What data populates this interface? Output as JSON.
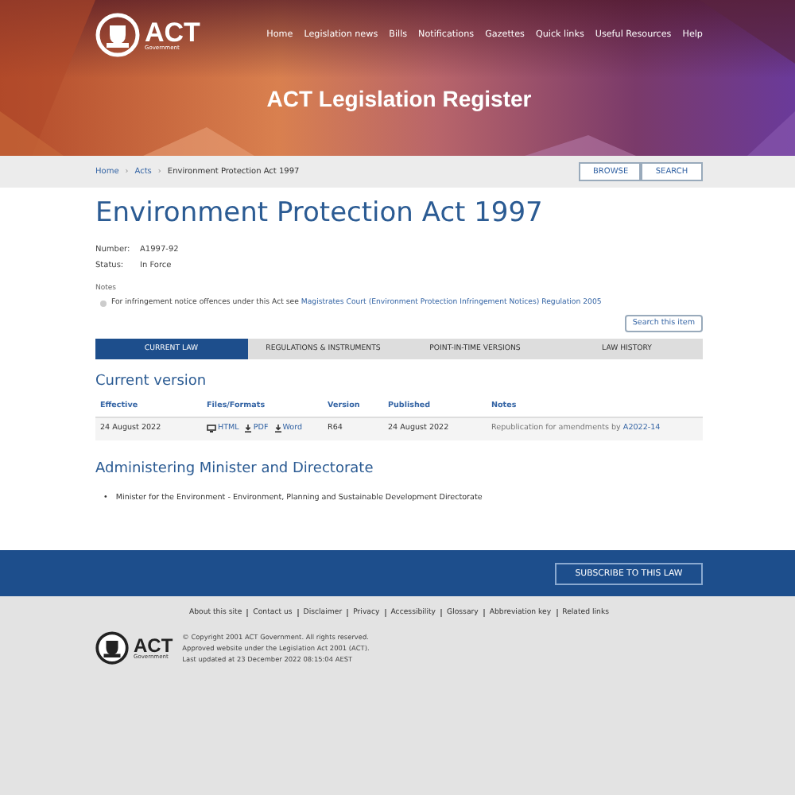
{
  "header": {
    "logo_text": "ACT",
    "logo_subtext": "Government",
    "nav": [
      "Home",
      "Legislation news",
      "Bills",
      "Notifications",
      "Gazettes",
      "Quick links",
      "Useful Resources",
      "Help"
    ],
    "site_title": "ACT Legislation Register"
  },
  "breadcrumb": {
    "separator": "›",
    "items": [
      "Home",
      "Acts",
      "Environment Protection Act 1997"
    ],
    "buttons": [
      "BROWSE",
      "SEARCH"
    ]
  },
  "title": "Environment Protection Act 1997",
  "details": [
    {
      "label": "Number:",
      "value": "A1997-92"
    },
    {
      "label": "Status:",
      "value": "In Force"
    }
  ],
  "notes_label": "Notes",
  "notes": [
    {
      "text": "For infringement notice offences under this Act see ",
      "link": "Magistrates Court (Environment Protection Infringement Notices) Regulation 2005"
    }
  ],
  "search_item_button": "Search this item",
  "tabs": [
    {
      "label": "CURRENT LAW",
      "selected": true
    },
    {
      "label": "REGULATIONS & INSTRUMENTS",
      "selected": false
    },
    {
      "label": "POINT-IN-TIME VERSIONS",
      "selected": false
    },
    {
      "label": "LAW HISTORY",
      "selected": false
    }
  ],
  "current_version": {
    "heading": "Current version",
    "columns": [
      "Effective",
      "Files/Formats",
      "Version",
      "Published",
      "Notes"
    ],
    "rows": [
      {
        "effective": "24 August 2022",
        "formats": [
          {
            "kind": "html",
            "label": "HTML"
          },
          {
            "kind": "download",
            "label": "PDF"
          },
          {
            "kind": "download",
            "label": "Word"
          }
        ],
        "version": "R64",
        "published": "24 August 2022",
        "note_text": "Republication for amendments by ",
        "note_link": "A2022-14"
      }
    ]
  },
  "administering": {
    "heading": "Administering Minister and Directorate",
    "items": [
      {
        "marker": "•",
        "text": "Minister for the Environment - Environment, Planning and Sustainable Development Directorate"
      }
    ]
  },
  "subscribe_button": "SUBSCRIBE TO THIS LAW",
  "footer": {
    "links": [
      "About this site",
      "Contact us",
      "Disclaimer",
      "Privacy",
      "Accessibility",
      "Glossary",
      "Abbreviation key",
      "Related links"
    ],
    "logo_text": "ACT",
    "logo_subtext": "Government",
    "lines": [
      "© Copyright 2001 ACT Government. All rights reserved.",
      "Approved website under the Legislation Act 2001 (ACT).",
      "Last updated at 23 December 2022 08:15:04 AEST"
    ]
  }
}
